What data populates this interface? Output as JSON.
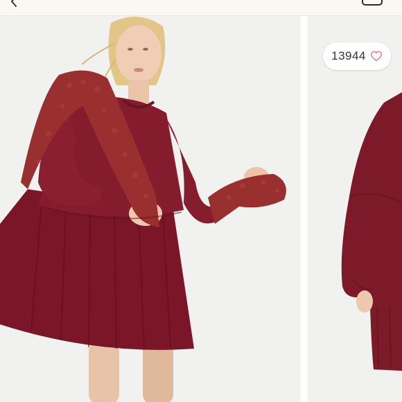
{
  "listing": {
    "like_count": "13944"
  },
  "icons": {
    "back": "chevron-left-icon",
    "like": "heart-outline-icon",
    "menu": "more-options-icon"
  },
  "colors": {
    "heart_accent": "#e07a8c",
    "dress": "#7b1a28",
    "sherpa": "#9a2f30",
    "background": "#f1f1f0"
  },
  "carousel": {
    "slides": [
      {
        "alt": "product-photo-1"
      },
      {
        "alt": "product-photo-2"
      }
    ]
  }
}
